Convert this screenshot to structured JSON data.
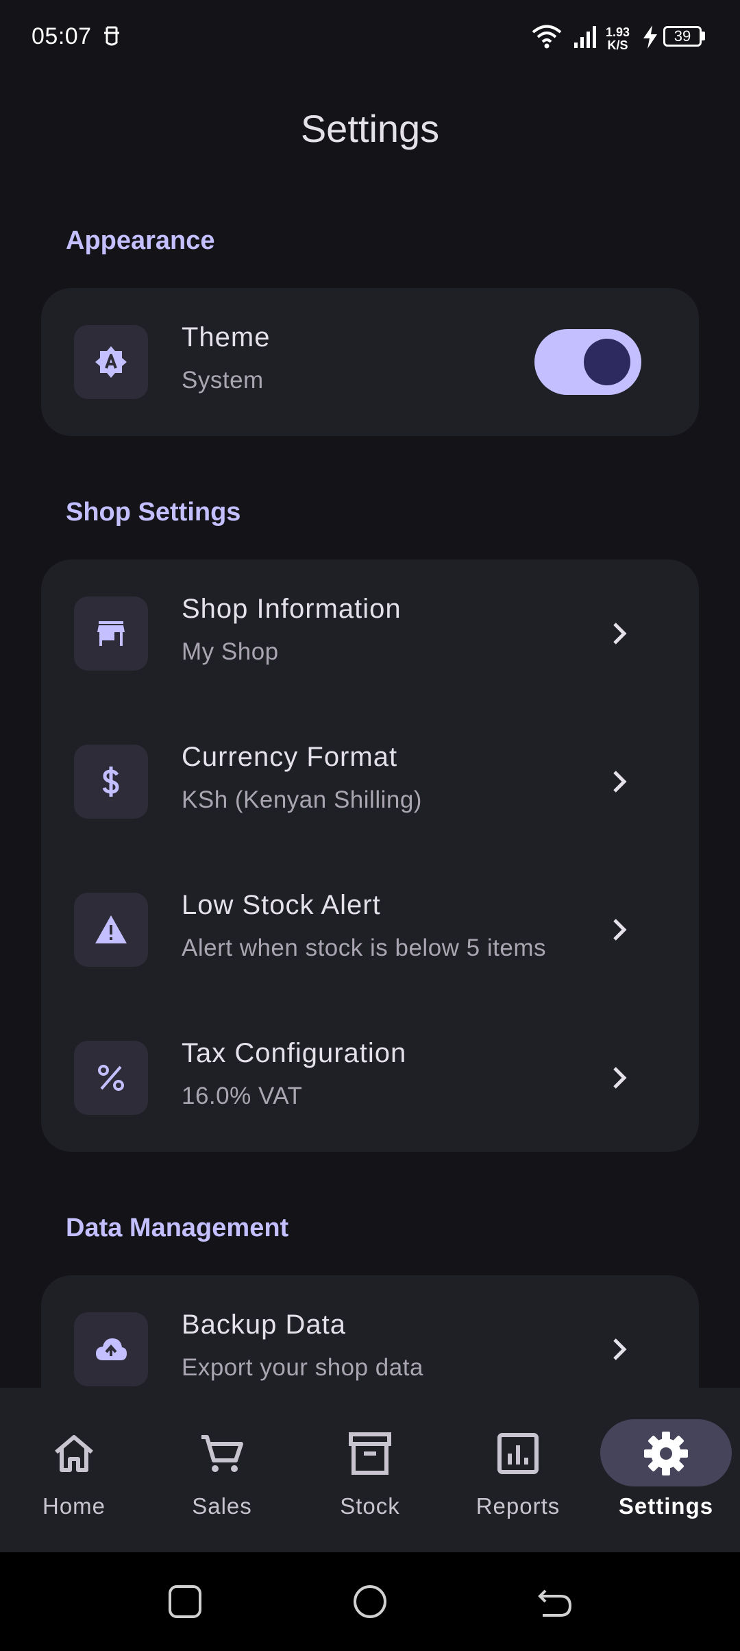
{
  "status_bar": {
    "time": "05:07",
    "net_speed_value": "1.93",
    "net_speed_unit": "K/S",
    "battery": "39",
    "icons": [
      "face-unlock-icon",
      "wifi-icon",
      "signal-icon",
      "charging-icon",
      "battery-icon"
    ]
  },
  "header": {
    "title": "Settings"
  },
  "sections": {
    "appearance": {
      "title": "Appearance",
      "theme": {
        "title": "Theme",
        "subtitle": "System",
        "icon": "theme-auto-icon",
        "toggle_on": true
      }
    },
    "shop_settings": {
      "title": "Shop Settings",
      "items": [
        {
          "title": "Shop Information",
          "subtitle": "My Shop",
          "icon": "store-icon"
        },
        {
          "title": "Currency Format",
          "subtitle": "KSh (Kenyan Shilling)",
          "icon": "dollar-icon"
        },
        {
          "title": "Low Stock Alert",
          "subtitle": "Alert when stock is below 5 items",
          "icon": "warning-icon"
        },
        {
          "title": "Tax Configuration",
          "subtitle": "16.0% VAT",
          "icon": "percent-icon"
        }
      ]
    },
    "data_management": {
      "title": "Data Management",
      "items": [
        {
          "title": "Backup Data",
          "subtitle": "Export your shop data",
          "icon": "cloud-upload-icon"
        }
      ]
    }
  },
  "bottom_nav": {
    "items": [
      {
        "label": "Home",
        "icon": "home-icon"
      },
      {
        "label": "Sales",
        "icon": "cart-icon"
      },
      {
        "label": "Stock",
        "icon": "archive-icon"
      },
      {
        "label": "Reports",
        "icon": "chart-icon"
      },
      {
        "label": "Settings",
        "icon": "gear-icon",
        "active": true
      }
    ]
  },
  "colors": {
    "background": "#131318",
    "card": "#1f1f26",
    "accent": "#c4c0ff",
    "icon_box": "#2d2c38",
    "nav_active_pill": "#46445a"
  }
}
